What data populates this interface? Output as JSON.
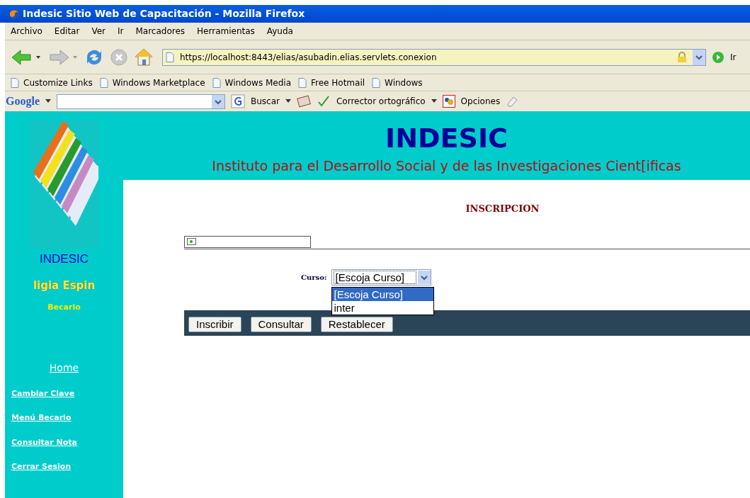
{
  "window": {
    "title": "Indesic Sitio Web de Capacitación - Mozilla Firefox"
  },
  "menu": [
    "Archivo",
    "Editar",
    "Ver",
    "Ir",
    "Marcadores",
    "Herramientas",
    "Ayuda"
  ],
  "address": {
    "url": "https://localhost:8443/elias/asubadin.elias.servlets.conexion",
    "go": "Ir"
  },
  "bookmarks": [
    "Customize Links",
    "Windows Marketplace",
    "Windows Media",
    "Free Hotmail",
    "Windows"
  ],
  "google_bar": {
    "brand": "Google",
    "search": "Buscar",
    "spell": "Corrector ortográfico",
    "options": "Opciones"
  },
  "site": {
    "title": "INDESIC",
    "subtitle": "Instituto para el Desarrollo Social y de las Investigaciones Cient[ificas"
  },
  "sidebar": {
    "logo_caption": "INDESIC",
    "user": "ligia Espin",
    "role": "Becario",
    "home": "Home",
    "links": [
      "Cambiar Clave",
      "Menú Becario",
      "Consultar Nota",
      "Cerrar Sesion"
    ]
  },
  "form": {
    "heading": "INSCRIPCION",
    "course_label": "Curso:",
    "course_value": "[Escoja Curso]",
    "options": [
      {
        "label": "[Escoja Curso]",
        "selected": true
      },
      {
        "label": "inter",
        "selected": false
      }
    ],
    "buttons": [
      "Inscribir",
      "Consultar",
      "Restablecer"
    ]
  }
}
